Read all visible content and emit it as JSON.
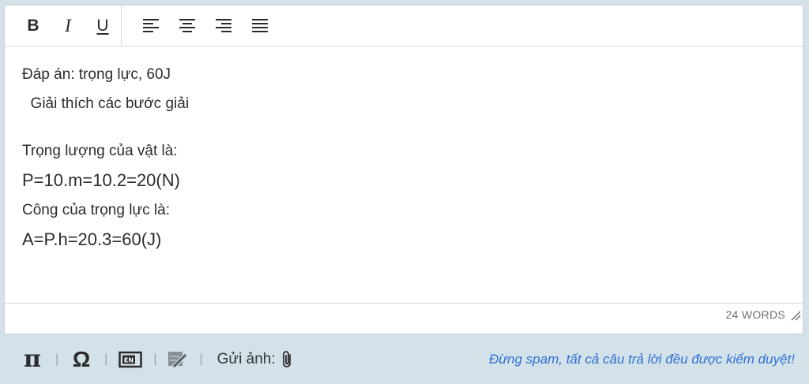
{
  "toolbar": {
    "bold_label": "B",
    "italic_label": "I",
    "underline_label": "U"
  },
  "content": {
    "lines": [
      "Đáp án: trọng lực, 60J",
      "  Giải thích các bước giải",
      "Trọng lượng của vật là:",
      "P=10.m=10.2=20(N)",
      "Công của trọng lực là:",
      "A=P.h=20.3=60(J)"
    ]
  },
  "status": {
    "word_count": "24 WORDS"
  },
  "bottom": {
    "pi_label": "π",
    "omega_label": "Ω",
    "send_image_label": "Gửi ảnh:",
    "warning_text": "Đừng spam, tất cả câu trả lời đều được kiểm duyệt!"
  },
  "colors": {
    "accent_blue": "#2f6fd6",
    "panel_bg": "#d3e2e8"
  }
}
